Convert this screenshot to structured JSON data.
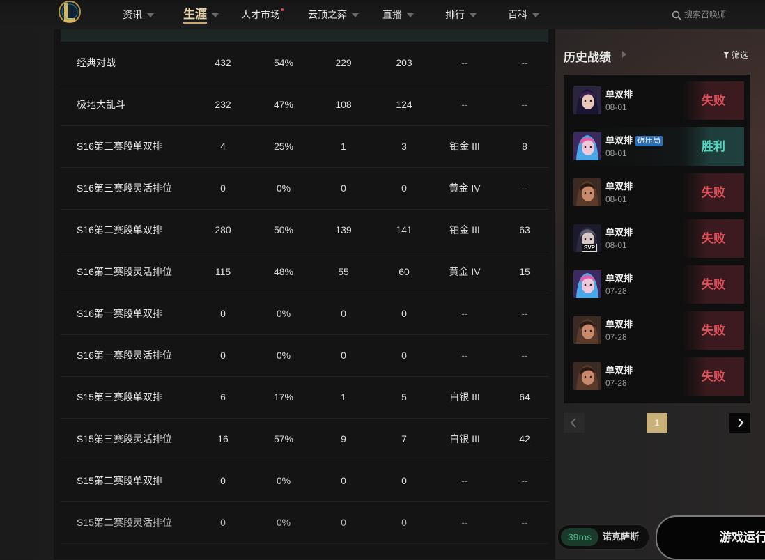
{
  "nav": {
    "items": [
      {
        "label": "资讯",
        "caret": true
      },
      {
        "label": "生涯",
        "caret": true,
        "active": true
      },
      {
        "label": "人才市场",
        "caret": false,
        "dot": true
      },
      {
        "label": "云顶之弈",
        "caret": true
      },
      {
        "label": "直播",
        "caret": true
      },
      {
        "label": "排行",
        "caret": true
      },
      {
        "label": "百科",
        "caret": true
      }
    ],
    "search_placeholder": "搜索召唤师"
  },
  "table": {
    "rows": [
      {
        "mode": "经典对战",
        "c1": "432",
        "c2": "54%",
        "c3": "229",
        "c4": "203",
        "c5": "--",
        "c6": "--"
      },
      {
        "mode": "极地大乱斗",
        "c1": "232",
        "c2": "47%",
        "c3": "108",
        "c4": "124",
        "c5": "--",
        "c6": "--"
      },
      {
        "mode": "S16第三赛段单双排",
        "c1": "4",
        "c2": "25%",
        "c3": "1",
        "c4": "3",
        "c5": "铂金 III",
        "c6": "8"
      },
      {
        "mode": "S16第三赛段灵活排位",
        "c1": "0",
        "c2": "0%",
        "c3": "0",
        "c4": "0",
        "c5": "黄金 IV",
        "c6": "--"
      },
      {
        "mode": "S16第二赛段单双排",
        "c1": "280",
        "c2": "50%",
        "c3": "139",
        "c4": "141",
        "c5": "铂金 III",
        "c6": "63"
      },
      {
        "mode": "S16第二赛段灵活排位",
        "c1": "115",
        "c2": "48%",
        "c3": "55",
        "c4": "60",
        "c5": "黄金 IV",
        "c6": "15"
      },
      {
        "mode": "S16第一赛段单双排",
        "c1": "0",
        "c2": "0%",
        "c3": "0",
        "c4": "0",
        "c5": "--",
        "c6": "--"
      },
      {
        "mode": "S16第一赛段灵活排位",
        "c1": "0",
        "c2": "0%",
        "c3": "0",
        "c4": "0",
        "c5": "--",
        "c6": "--"
      },
      {
        "mode": "S15第三赛段单双排",
        "c1": "6",
        "c2": "17%",
        "c3": "1",
        "c4": "5",
        "c5": "白银 III",
        "c6": "64"
      },
      {
        "mode": "S15第三赛段灵活排位",
        "c1": "16",
        "c2": "57%",
        "c3": "9",
        "c4": "7",
        "c5": "白银 III",
        "c6": "42"
      },
      {
        "mode": "S15第二赛段单双排",
        "c1": "0",
        "c2": "0%",
        "c3": "0",
        "c4": "0",
        "c5": "--",
        "c6": "--"
      },
      {
        "mode": "S15第二赛段灵活排位",
        "c1": "0",
        "c2": "0%",
        "c3": "0",
        "c4": "0",
        "c5": "--",
        "c6": "--"
      }
    ]
  },
  "history": {
    "title": "历史战绩",
    "filter_label": "筛选",
    "matches": [
      {
        "queue": "单双排",
        "date": "08-01",
        "result": "失败",
        "outcome": "loss",
        "champ": "dark-hair-champion-icon"
      },
      {
        "queue": "单双排",
        "tag": "碾压局",
        "date": "08-01",
        "result": "胜利",
        "outcome": "win",
        "champ": "blue-hair-champion-icon"
      },
      {
        "queue": "单双排",
        "date": "08-01",
        "result": "失败",
        "outcome": "loss",
        "champ": "bearded-champion-icon"
      },
      {
        "queue": "单双排",
        "date": "08-01",
        "result": "失败",
        "outcome": "loss",
        "champ": "svp-champion-icon",
        "badge": "SVP"
      },
      {
        "queue": "单双排",
        "date": "07-28",
        "result": "失败",
        "outcome": "loss",
        "champ": "blue-hair-champion-icon"
      },
      {
        "queue": "单双排",
        "date": "07-28",
        "result": "失败",
        "outcome": "loss",
        "champ": "bearded-champion-icon"
      },
      {
        "queue": "单双排",
        "date": "07-28",
        "result": "失败",
        "outcome": "loss",
        "champ": "bearded-champion-icon"
      }
    ],
    "page": "1"
  },
  "status": {
    "ping": "39ms",
    "server": "诺克萨斯",
    "launch_label": "游戏运行"
  },
  "colors": {
    "accent_gold": "#c9b279",
    "loss": "#e0505a",
    "win": "#4fd6c0",
    "ping": "#4fb98a"
  }
}
